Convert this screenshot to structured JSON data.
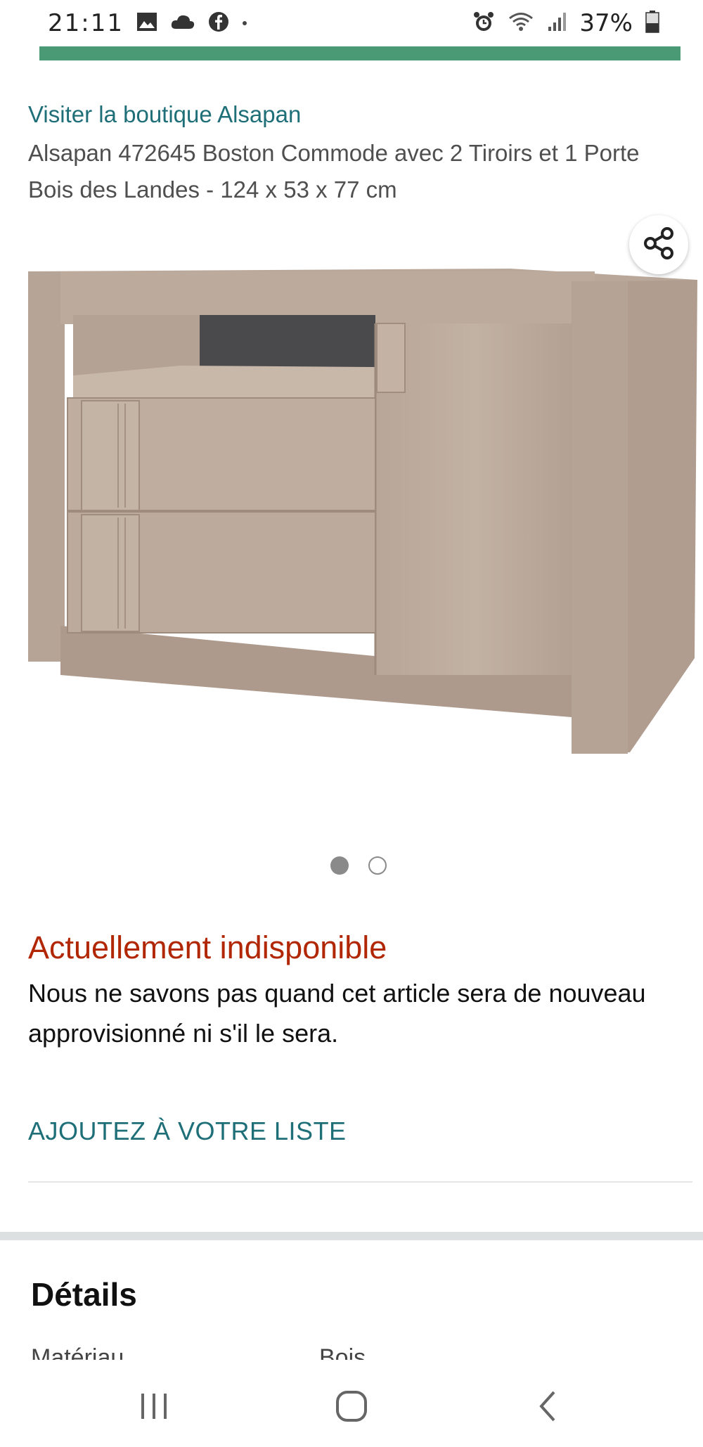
{
  "status_bar": {
    "time": "21:11",
    "battery_text": "37%",
    "icons": [
      "image-icon",
      "cloud-icon",
      "facebook-icon",
      "dot-icon",
      "alarm-icon",
      "wifi-icon",
      "signal-icon",
      "battery-icon"
    ]
  },
  "page_load_progress": 1.0,
  "product": {
    "store_link": "Visiter la boutique Alsapan",
    "title": "Alsapan 472645 Boston Commode avec 2 Tiroirs et 1 Porte Bois des Landes - 124 x 53 x 77 cm",
    "image_count": 2,
    "active_image": 1
  },
  "availability": {
    "status": "Actuellement indisponible",
    "detail": "Nous ne savons pas quand cet article sera de nouveau approvisionné ni s'il le sera."
  },
  "actions": {
    "add_to_list": "AJOUTEZ À VOTRE LISTE"
  },
  "details": {
    "heading": "Détails",
    "rows": [
      {
        "label": "Matériau",
        "value": "Bois"
      }
    ]
  },
  "nav": {
    "icons": [
      "recent-apps-icon",
      "home-icon",
      "back-icon"
    ]
  },
  "colors": {
    "accent_link": "#1f6f78",
    "unavailable": "#b12704",
    "progress": "#4a9a76"
  }
}
